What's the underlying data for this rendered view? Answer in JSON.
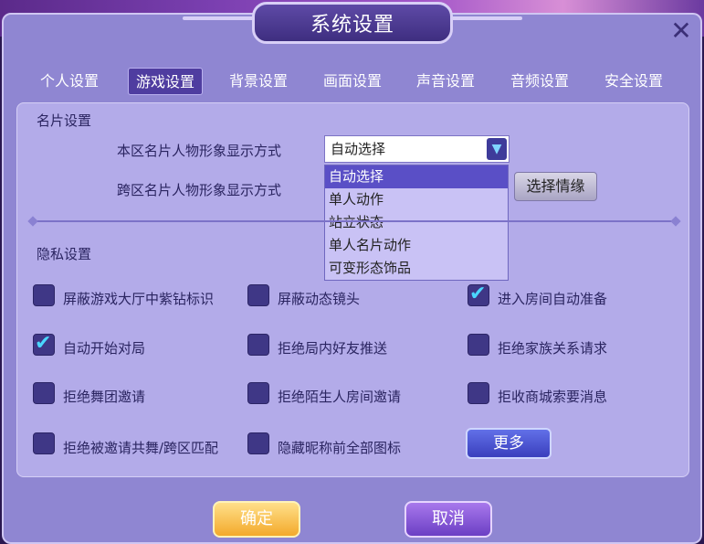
{
  "window": {
    "title": "系统设置",
    "close_icon": "close-icon"
  },
  "tabs": [
    {
      "label": "个人设置",
      "active": false
    },
    {
      "label": "游戏设置",
      "active": true
    },
    {
      "label": "背景设置",
      "active": false
    },
    {
      "label": "画面设置",
      "active": false
    },
    {
      "label": "声音设置",
      "active": false
    },
    {
      "label": "音频设置",
      "active": false
    },
    {
      "label": "安全设置",
      "active": false
    }
  ],
  "card_settings": {
    "section_title": "名片设置",
    "local_label": "本区名片人物形象显示方式",
    "cross_label": "跨区名片人物形象显示方式",
    "select_value": "自动选择",
    "options": [
      "自动选择",
      "单人动作",
      "站立状态",
      "单人名片动作",
      "可变形态饰品"
    ],
    "selected_option": "自动选择",
    "choose_button": "选择情缘"
  },
  "privacy": {
    "section_title": "隐私设置",
    "items": [
      {
        "label": "屏蔽游戏大厅中紫钻标识",
        "checked": false
      },
      {
        "label": "屏蔽动态镜头",
        "checked": false
      },
      {
        "label": "进入房间自动准备",
        "checked": true
      },
      {
        "label": "自动开始对局",
        "checked": true
      },
      {
        "label": "拒绝局内好友推送",
        "checked": false
      },
      {
        "label": "拒绝家族关系请求",
        "checked": false
      },
      {
        "label": "拒绝舞团邀请",
        "checked": false
      },
      {
        "label": "拒绝陌生人房间邀请",
        "checked": false
      },
      {
        "label": "拒收商城索要消息",
        "checked": false
      },
      {
        "label": "拒绝被邀请共舞/跨区匹配",
        "checked": false
      },
      {
        "label": "隐藏昵称前全部图标",
        "checked": false
      }
    ],
    "more_button": "更多"
  },
  "footer": {
    "ok_button": "确定",
    "cancel_button": "取消"
  },
  "colors": {
    "panel": "#b3abe9",
    "dialog": "#8f86d2",
    "accent": "#5a4fc6",
    "check": "#4ad7ff"
  }
}
